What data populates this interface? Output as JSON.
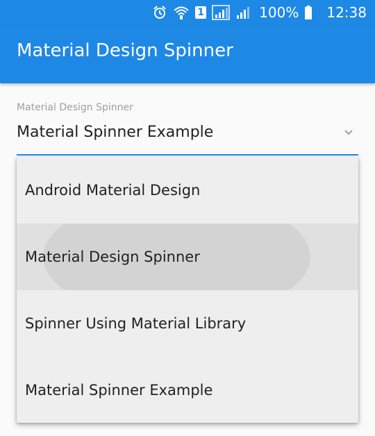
{
  "status_bar": {
    "icons": [
      "alarm-icon",
      "wifi-icon",
      "sim-icon",
      "signal-icon",
      "signal-icon",
      "battery-icon"
    ],
    "sim_slot": "1",
    "battery": "100%",
    "time": "12:38"
  },
  "app_bar": {
    "title": "Material Design Spinner"
  },
  "spinner": {
    "floating_label": "Material Design Spinner",
    "selected_value": "Material Spinner Example",
    "accent_color": "#1e88e5",
    "icon": "chevron-down-icon"
  },
  "dropdown": {
    "highlighted_index": 1,
    "items": [
      {
        "label": "Android Material Design"
      },
      {
        "label": "Material Design Spinner"
      },
      {
        "label": "Spinner Using Material Library"
      },
      {
        "label": "Material Spinner Example"
      }
    ]
  }
}
